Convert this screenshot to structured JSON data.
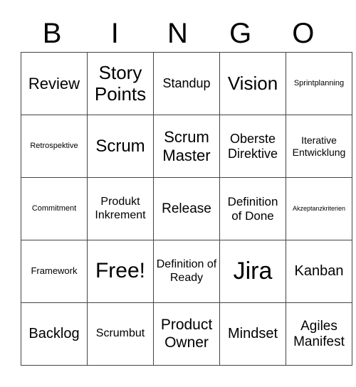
{
  "header": [
    "B",
    "I",
    "N",
    "G",
    "O"
  ],
  "rows": [
    [
      "Review",
      "Story Points",
      "Standup",
      "Vision",
      "Sprintplanning"
    ],
    [
      "Retrospektive",
      "Scrum",
      "Scrum Master",
      "Oberste Direktive",
      "Iterative Entwicklung"
    ],
    [
      "Commitment",
      "Produkt Inkrement",
      "Release",
      "Definition of Done",
      "Akzeptanzkriterien"
    ],
    [
      "Framework",
      "Free!",
      "Definition of Ready",
      "Jira",
      "Kanban"
    ],
    [
      "Backlog",
      "Scrumbut",
      "Product Owner",
      "Mindset",
      "Agiles Manifest"
    ]
  ]
}
